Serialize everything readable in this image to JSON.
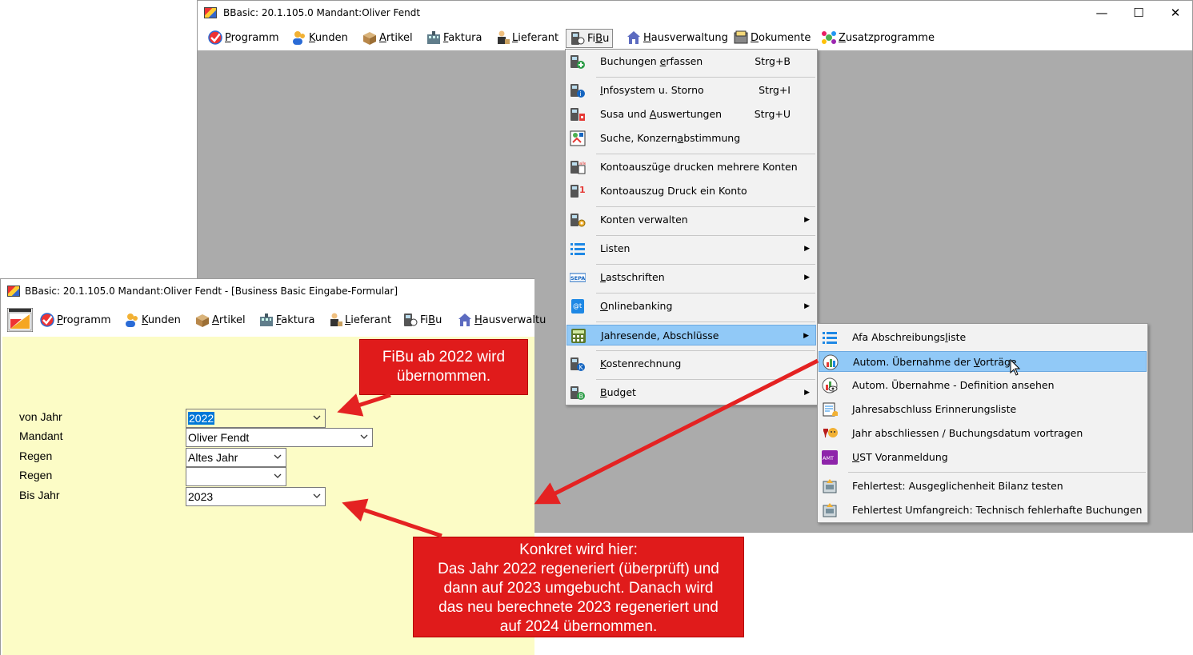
{
  "main_window": {
    "title": "BBasic: 20.1.105.0 Mandant:Oliver Fendt",
    "controls": {
      "minimize": "—",
      "maximize": "☐",
      "close": "✕"
    },
    "menu": [
      {
        "icon": "programm-icon",
        "pre": "",
        "u": "P",
        "post": "rogramm"
      },
      {
        "icon": "kunden-icon",
        "pre": "",
        "u": "K",
        "post": "unden"
      },
      {
        "icon": "artikel-icon",
        "pre": "",
        "u": "A",
        "post": "rtikel"
      },
      {
        "icon": "faktura-icon",
        "pre": "",
        "u": "F",
        "post": "aktura"
      },
      {
        "icon": "lieferant-icon",
        "pre": "",
        "u": "L",
        "post": "ieferant"
      },
      {
        "icon": "fibu-icon",
        "pre": "Fi",
        "u": "B",
        "post": "u"
      },
      {
        "icon": "hausverwaltung-icon",
        "pre": "",
        "u": "H",
        "post": "ausverwaltung"
      },
      {
        "icon": "dokumente-icon",
        "pre": "",
        "u": "D",
        "post": "okumente"
      },
      {
        "icon": "zusatzprogramme-icon",
        "pre": "",
        "u": "Z",
        "post": "usatzprogramme"
      }
    ]
  },
  "fibu_menu": [
    {
      "pre": "Buchungen ",
      "u": "e",
      "post": "rfassen",
      "shortcut": "Strg+B",
      "icon": "buchungen-icon"
    },
    {
      "pre": "",
      "u": "I",
      "post": "nfosystem u. Storno",
      "shortcut": "Strg+I",
      "icon": "infosystem-icon"
    },
    {
      "pre": "Susa und ",
      "u": "A",
      "post": "uswertungen",
      "shortcut": "Strg+U",
      "icon": "susa-icon"
    },
    {
      "pre": "Suche, Konzern",
      "u": "a",
      "post": "bstimmung",
      "shortcut": "",
      "icon": "suche-icon"
    },
    {
      "pre": "Kontoauszüge drucken mehrere Konten",
      "u": "",
      "post": "",
      "shortcut": "",
      "icon": "kontoauszuege-icon"
    },
    {
      "pre": "Kontoauszug Druck ein Konto",
      "u": "",
      "post": "",
      "shortcut": "",
      "icon": "kontoauszug-icon"
    },
    {
      "pre": "Konten verwalten",
      "u": "",
      "post": "",
      "shortcut": "",
      "icon": "konten-icon"
    },
    {
      "pre": "Listen",
      "u": "",
      "post": "",
      "shortcut": "",
      "icon": "listen-icon"
    },
    {
      "pre": "",
      "u": "L",
      "post": "astschriften",
      "shortcut": "",
      "icon": "sepa-icon"
    },
    {
      "pre": "",
      "u": "O",
      "post": "nlinebanking",
      "shortcut": "",
      "icon": "onlinebanking-icon"
    },
    {
      "pre": "",
      "u": "J",
      "post": "ahresende, Abschlüsse",
      "shortcut": "",
      "icon": "jahresende-icon"
    },
    {
      "pre": "",
      "u": "K",
      "post": "ostenrechnung",
      "shortcut": "",
      "icon": "kostenrechnung-icon"
    },
    {
      "pre": "",
      "u": "B",
      "post": "udget",
      "shortcut": "",
      "icon": "budget-icon"
    }
  ],
  "submenu_arrow": "▶",
  "jahresende_menu": [
    {
      "pre": "Afa Abschreibungs",
      "u": "l",
      "post": "iste",
      "icon": "afa-list-icon"
    },
    {
      "pre": "Autom. Übernahme der ",
      "u": "V",
      "post": "orträge",
      "icon": "uebernahme-chart-icon"
    },
    {
      "pre": "Autom. Übernahme - Definition ansehen",
      "u": "",
      "post": "",
      "icon": "definition-eye-icon"
    },
    {
      "pre": "Jahresabschluss Erinnerungsliste",
      "u": "",
      "post": "",
      "icon": "erinnerung-bell-icon"
    },
    {
      "pre": "Jahr abschliessen / Buchungsdatum vortragen",
      "u": "",
      "post": "",
      "icon": "jahr-abschliessen-icon"
    },
    {
      "pre": "",
      "u": "U",
      "post": "ST Voranmeldung",
      "icon": "ust-amt-icon"
    },
    {
      "pre": "Fehlertest: Ausgeglichenheit Bilanz testen",
      "u": "",
      "post": "",
      "icon": "fehlertest-icon"
    },
    {
      "pre": "Fehlertest Umfangreich: Technisch fehlerhafte Buchungen",
      "u": "",
      "post": "",
      "icon": "fehlertest-umfangreich-icon"
    }
  ],
  "form_window": {
    "title": "BBasic: 20.1.105.0 Mandant:Oliver Fendt  - [Business Basic Eingabe-Formular]",
    "menu": [
      {
        "icon": "programm-icon",
        "pre": "",
        "u": "P",
        "post": "rogramm"
      },
      {
        "icon": "kunden-icon",
        "pre": "",
        "u": "K",
        "post": "unden"
      },
      {
        "icon": "artikel-icon",
        "pre": "",
        "u": "A",
        "post": "rtikel"
      },
      {
        "icon": "faktura-icon",
        "pre": "",
        "u": "F",
        "post": "aktura"
      },
      {
        "icon": "lieferant-icon",
        "pre": "",
        "u": "L",
        "post": "ieferant"
      },
      {
        "icon": "fibu-icon",
        "pre": "Fi",
        "u": "B",
        "post": "u"
      },
      {
        "icon": "hausverwaltung-icon",
        "pre": "",
        "u": "H",
        "post": "ausverwaltu"
      }
    ],
    "fields": [
      {
        "label": "von Jahr",
        "value": "2022"
      },
      {
        "label": "Mandant",
        "value": "Oliver Fendt"
      },
      {
        "label": "Regen",
        "value": "Altes Jahr"
      },
      {
        "label": "Regen",
        "value": ""
      },
      {
        "label": "Bis Jahr",
        "value": "2023"
      }
    ]
  },
  "callouts": {
    "top": [
      "FiBu ab 2022 wird",
      "übernommen."
    ],
    "bottom": [
      "Konkret wird hier:",
      "Das Jahr 2022 regeneriert (überprüft) und",
      "dann auf 2023 umgebucht. Danach wird",
      "das neu berechnete 2023 regeneriert und",
      "auf 2024 übernommen."
    ]
  },
  "colors": {
    "callout_red": "#e01b1b",
    "form_background": "#fcfcc6",
    "menu_highlight": "#91c9f7",
    "mdi_background": "#ababab"
  }
}
